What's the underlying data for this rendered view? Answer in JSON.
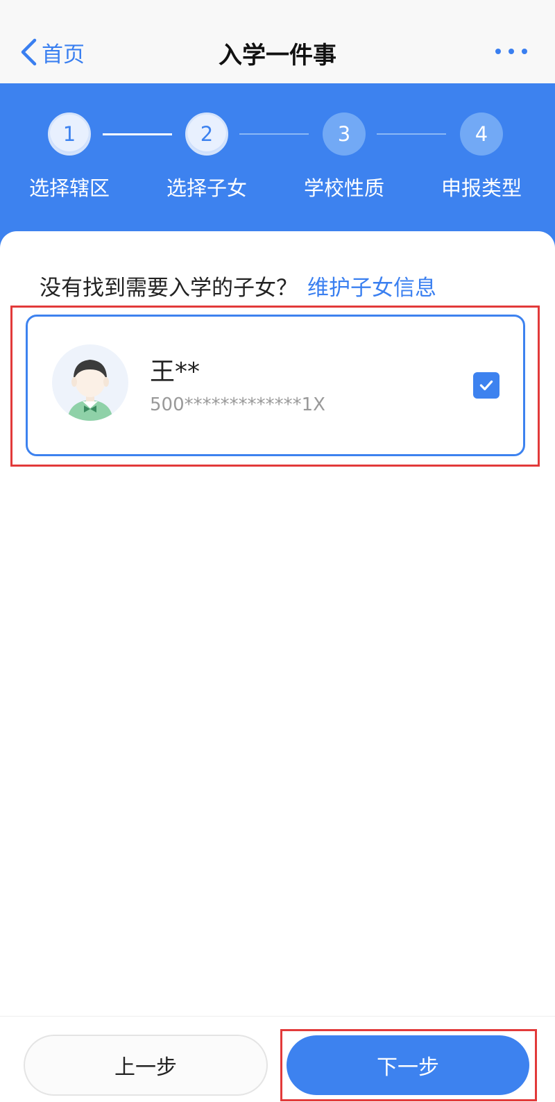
{
  "nav": {
    "back_label": "首页",
    "title": "入学一件事",
    "back_icon": "chevron-left-icon",
    "more_icon": "more-dots-icon"
  },
  "steps": [
    {
      "number": "1",
      "label": "选择辖区",
      "state": "done"
    },
    {
      "number": "2",
      "label": "选择子女",
      "state": "done"
    },
    {
      "number": "3",
      "label": "学校性质",
      "state": "todo"
    },
    {
      "number": "4",
      "label": "申报类型",
      "state": "todo"
    }
  ],
  "hint": {
    "text": "没有找到需要入学的子女？",
    "link": "维护子女信息"
  },
  "child": {
    "name": "王**",
    "id_number": "500*************1X",
    "selected": true,
    "avatar_icon": "child-avatar-icon",
    "check_icon": "checkmark-icon"
  },
  "footer": {
    "prev_label": "上一步",
    "next_label": "下一步"
  },
  "colors": {
    "primary": "#3d82ef",
    "highlight_frame": "#e23a3a"
  }
}
